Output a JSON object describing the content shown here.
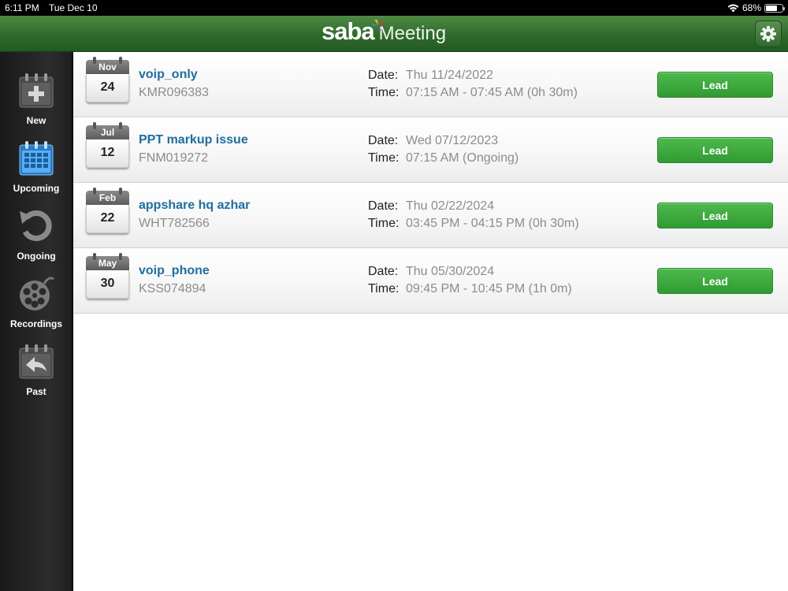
{
  "status_bar": {
    "time": "6:11 PM",
    "date": "Tue Dec 10",
    "battery": "68%",
    "battery_level": 0.68
  },
  "header": {
    "logo_word": "saba",
    "logo_suffix": "Meeting",
    "settings_icon": "gear-icon"
  },
  "sidebar": {
    "items": [
      {
        "label": "New",
        "icon": "calendar-add-icon"
      },
      {
        "label": "Upcoming",
        "icon": "calendar-grid-icon",
        "selected": true
      },
      {
        "label": "Ongoing",
        "icon": "refresh-arrow-icon"
      },
      {
        "label": "Recordings",
        "icon": "film-reel-icon"
      },
      {
        "label": "Past",
        "icon": "calendar-back-icon"
      }
    ]
  },
  "meetings": [
    {
      "month": "Nov",
      "day": "24",
      "title": "voip_only",
      "code": "KMR096383",
      "date_label": "Date:",
      "date": "Thu 11/24/2022",
      "time_label": "Time:",
      "time": "07:15 AM - 07:45 AM (0h 30m)",
      "action": "Lead"
    },
    {
      "month": "Jul",
      "day": "12",
      "title": "PPT markup issue",
      "code": "FNM019272",
      "date_label": "Date:",
      "date": "Wed 07/12/2023",
      "time_label": "Time:",
      "time": "07:15 AM (Ongoing)",
      "action": "Lead"
    },
    {
      "month": "Feb",
      "day": "22",
      "title": "appshare hq azhar",
      "code": "WHT782566",
      "date_label": "Date:",
      "date": "Thu 02/22/2024",
      "time_label": "Time:",
      "time": "03:45 PM - 04:15 PM (0h 30m)",
      "action": "Lead"
    },
    {
      "month": "May",
      "day": "30",
      "title": "voip_phone",
      "code": "KSS074894",
      "date_label": "Date:",
      "date": "Thu 05/30/2024",
      "time_label": "Time:",
      "time": "09:45 PM - 10:45 PM (1h 0m)",
      "action": "Lead"
    }
  ],
  "colors": {
    "header_green": "#2f6a2c",
    "lead_green": "#3aa83c",
    "title_blue": "#1f6e9e",
    "upcoming_blue": "#3a9ee6"
  }
}
